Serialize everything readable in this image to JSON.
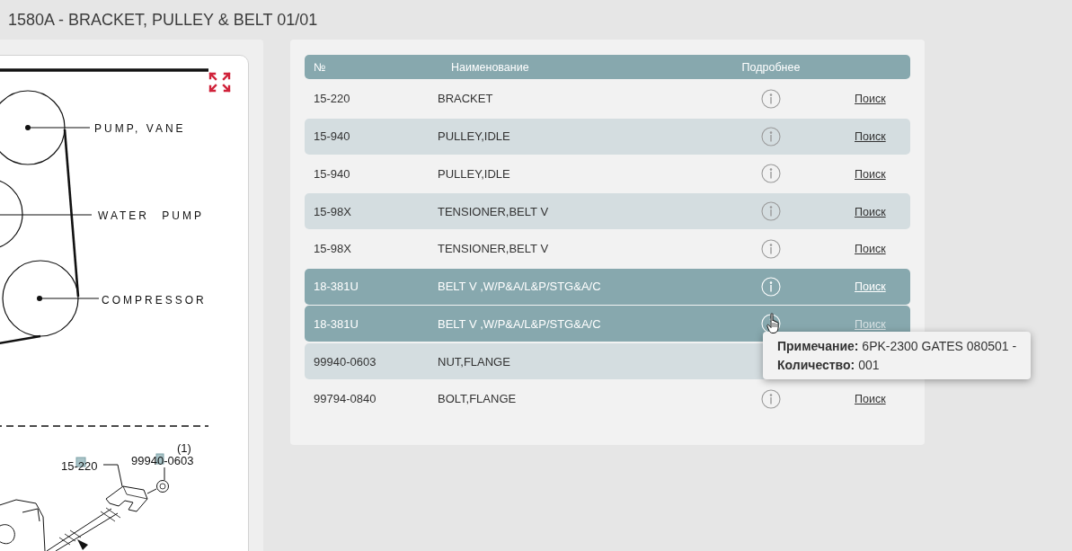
{
  "title": "1580A - BRACKET, PULLEY & BELT 01/01",
  "diagram": {
    "labels": [
      "PUMP, VANE",
      "WATER PUMP",
      "COMPRESSOR",
      "15-220",
      "(1)",
      "99940-0603"
    ]
  },
  "table": {
    "columns": [
      "№",
      "Наименование",
      "Подробнее"
    ],
    "rows": [
      {
        "number": "15-220",
        "name": "BRACKET",
        "link": "Поиск",
        "selected": false
      },
      {
        "number": "15-940",
        "name": "PULLEY,IDLE",
        "link": "Поиск",
        "selected": false
      },
      {
        "number": "15-940",
        "name": "PULLEY,IDLE",
        "link": "Поиск",
        "selected": false
      },
      {
        "number": "15-98X",
        "name": "TENSIONER,BELT V",
        "link": "Поиск",
        "selected": false
      },
      {
        "number": "15-98X",
        "name": "TENSIONER,BELT V",
        "link": "Поиск",
        "selected": false
      },
      {
        "number": "18-381U",
        "name": "BELT V ,W/P&A/L&P/STG&A/C",
        "link": "Поиск",
        "selected": true
      },
      {
        "number": "18-381U",
        "name": "BELT V ,W/P&A/L&P/STG&A/C",
        "link": "Поиск",
        "selected": true,
        "tooltip": {
          "note": "**Примечание:** 6PK-2300 GATES 080501 -",
          "quantity": "**Количество:** 001"
        }
      },
      {
        "number": "99940-0603",
        "name": "NUT,FLANGE",
        "selected": false
      },
      {
        "number": "99794-0840",
        "name": "BOLT,FLANGE",
        "link": "Поиск",
        "selected": false
      }
    ]
  }
}
